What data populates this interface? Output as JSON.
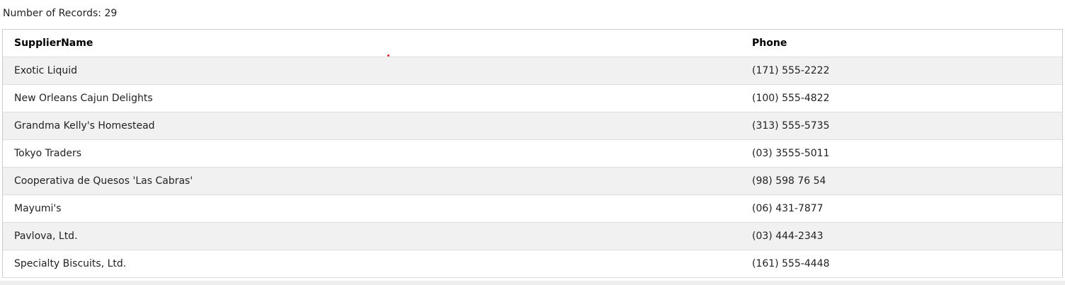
{
  "record_count_label": "Number of Records: 29",
  "table": {
    "headers": [
      "SupplierName",
      "Phone"
    ],
    "rows": [
      {
        "supplier": "Exotic Liquid",
        "phone": "(171) 555-2222"
      },
      {
        "supplier": "New Orleans Cajun Delights",
        "phone": "(100) 555-4822"
      },
      {
        "supplier": "Grandma Kelly's Homestead",
        "phone": "(313) 555-5735"
      },
      {
        "supplier": "Tokyo Traders",
        "phone": "(03) 3555-5011"
      },
      {
        "supplier": "Cooperativa de Quesos 'Las Cabras'",
        "phone": "(98) 598 76 54"
      },
      {
        "supplier": "Mayumi's",
        "phone": "(06) 431-7877"
      },
      {
        "supplier": "Pavlova, Ltd.",
        "phone": "(03) 444-2343"
      },
      {
        "supplier": "Specialty Biscuits, Ltd.",
        "phone": "(161) 555-4448"
      }
    ]
  },
  "colors": {
    "row_alt": "#f1f1f1",
    "border": "#dddddd",
    "marker": "#e0201e"
  }
}
